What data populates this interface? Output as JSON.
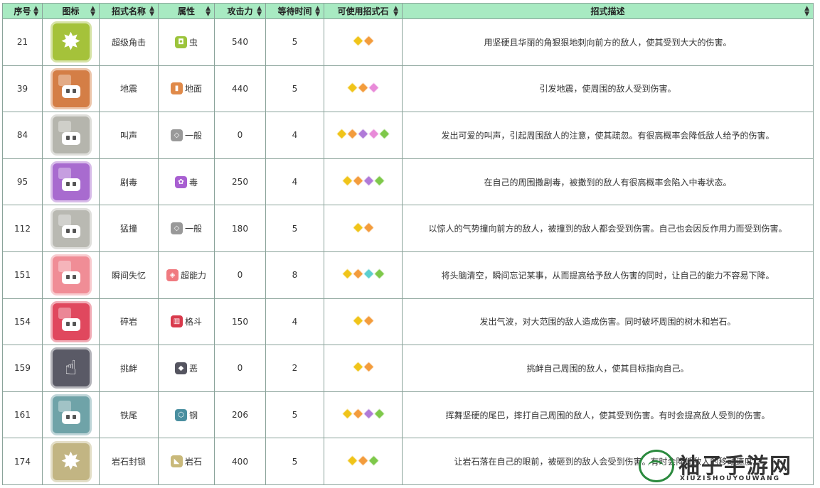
{
  "columns": [
    "序号",
    "图标",
    "招式名称",
    "属性",
    "攻击力",
    "等待时间",
    "可使用招式石",
    "招式描述"
  ],
  "rows": [
    {
      "no": "21",
      "icon": "spiky-burst-icon",
      "iconColor": "#a5c23a",
      "name": "超级角击",
      "typeIcon": "bug-type-icon",
      "typeColor": "#9cc43c",
      "typeGlyph": "◘",
      "type": "虫",
      "power": "540",
      "wait": "5",
      "stones": [
        "#f0c419",
        "#f39c3c"
      ],
      "desc": "用坚硬且华丽的角狠狠地刺向前方的敌人，使其受到大大的伤害。"
    },
    {
      "no": "39",
      "icon": "earthquake-robot-icon",
      "iconColor": "#d47e46",
      "name": "地震",
      "typeIcon": "ground-type-icon",
      "typeColor": "#e08a4a",
      "typeGlyph": "▮",
      "type": "地面",
      "power": "440",
      "wait": "5",
      "stones": [
        "#f0c419",
        "#f39c3c",
        "#e88ad8"
      ],
      "desc": "引发地震，使周围的敌人受到伤害。"
    },
    {
      "no": "84",
      "icon": "growl-robot-icon",
      "iconColor": "#b5b5ad",
      "name": "叫声",
      "typeIcon": "normal-type-icon",
      "typeColor": "#999999",
      "typeGlyph": "◇",
      "type": "一般",
      "power": "0",
      "wait": "4",
      "stones": [
        "#f0c419",
        "#f39c3c",
        "#b07ad8",
        "#e88ad8",
        "#7ec84a"
      ],
      "desc": "发出可爱的叫声，引起周围敌人的注意，使其疏忽。有很高概率会降低敌人给予的伤害。"
    },
    {
      "no": "95",
      "icon": "toxic-robot-icon",
      "iconColor": "#a86bcf",
      "name": "剧毒",
      "typeIcon": "poison-type-icon",
      "typeColor": "#a85fd1",
      "typeGlyph": "✿",
      "type": "毒",
      "power": "250",
      "wait": "4",
      "stones": [
        "#f0c419",
        "#f39c3c",
        "#b07ad8",
        "#7ec84a"
      ],
      "desc": "在自己的周围撒剧毒，被撒到的敌人有很高概率会陷入中毒状态。"
    },
    {
      "no": "112",
      "icon": "tackle-robot-icon",
      "iconColor": "#b9b9b2",
      "name": "猛撞",
      "typeIcon": "normal-type-icon",
      "typeColor": "#999999",
      "typeGlyph": "◇",
      "type": "一般",
      "power": "180",
      "wait": "5",
      "stones": [
        "#f0c419",
        "#f39c3c"
      ],
      "desc": "以惊人的气势撞向前方的敌人，被撞到的敌人都会受到伤害。自己也会因反作用力而受到伤害。"
    },
    {
      "no": "151",
      "icon": "amnesia-robot-icon",
      "iconColor": "#f08d96",
      "name": "瞬间失忆",
      "typeIcon": "psychic-type-icon",
      "typeColor": "#f07a80",
      "typeGlyph": "◈",
      "type": "超能力",
      "power": "0",
      "wait": "8",
      "stones": [
        "#f0c419",
        "#f39c3c",
        "#5ccfcf",
        "#7ec84a"
      ],
      "desc": "将头脑清空，瞬间忘记某事，从而提高给予敌人伤害的同时，让自己的能力不容易下降。"
    },
    {
      "no": "154",
      "icon": "rock-smash-robot-icon",
      "iconColor": "#e0485e",
      "name": "碎岩",
      "typeIcon": "fighting-type-icon",
      "typeColor": "#d83a4c",
      "typeGlyph": "▥",
      "type": "格斗",
      "power": "150",
      "wait": "4",
      "stones": [
        "#f0c419",
        "#f39c3c"
      ],
      "desc": "发出气波，对大范围的敌人造成伤害。同时破坏周围的树木和岩石。"
    },
    {
      "no": "159",
      "icon": "taunt-hand-icon",
      "iconColor": "#5a5a66",
      "name": "挑衅",
      "typeIcon": "dark-type-icon",
      "typeColor": "#555560",
      "typeGlyph": "◆",
      "type": "恶",
      "power": "0",
      "wait": "2",
      "stones": [
        "#f0c419",
        "#f39c3c"
      ],
      "desc": "挑衅自己周围的敌人，使其目标指向自己。"
    },
    {
      "no": "161",
      "icon": "iron-tail-robot-icon",
      "iconColor": "#6fa3a8",
      "name": "铁尾",
      "typeIcon": "steel-type-icon",
      "typeColor": "#4a8fa0",
      "typeGlyph": "⬡",
      "type": "钢",
      "power": "206",
      "wait": "5",
      "stones": [
        "#f0c419",
        "#f39c3c",
        "#b07ad8",
        "#7ec84a"
      ],
      "desc": "挥舞坚硬的尾巴，摔打自己周围的敌人，使其受到伤害。有时会提高敌人受到的伤害。"
    },
    {
      "no": "174",
      "icon": "rock-tomb-burst-icon",
      "iconColor": "#c2b583",
      "name": "岩石封锁",
      "typeIcon": "rock-type-icon",
      "typeColor": "#c9b97a",
      "typeGlyph": "◣",
      "type": "岩石",
      "power": "400",
      "wait": "5",
      "stones": [
        "#f0c419",
        "#f39c3c",
        "#7ec84a"
      ],
      "desc": "让岩石落在自己的眼前，被砸到的敌人会受到伤害。有时会降低敌人的移动速度。"
    }
  ],
  "watermark": {
    "title": "袖子手游网",
    "subtitle": "XIUZISHOUYOUWANG"
  }
}
